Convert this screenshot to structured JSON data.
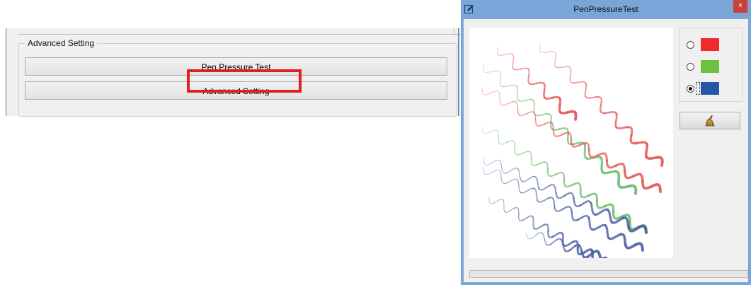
{
  "settings": {
    "group_title": "Advanced Setting",
    "pen_pressure_button": "Pen Pressure Test",
    "advanced_setting_button": "Advanced Setting",
    "highlight_color": "#e21d24"
  },
  "dialog": {
    "title": "PenPressureTest",
    "close_glyph": "×",
    "title_icon": "edit-icon",
    "colors": [
      {
        "name": "red",
        "hex": "#ef2a2a",
        "selected": false
      },
      {
        "name": "green",
        "hex": "#6cc142",
        "selected": false
      },
      {
        "name": "blue",
        "hex": "#2457a8",
        "selected": true
      }
    ],
    "clear_icon": "broom-icon",
    "stroke_colors": {
      "red": "#e55656",
      "green": "#69bb69",
      "blue": "#4d60a4"
    }
  }
}
